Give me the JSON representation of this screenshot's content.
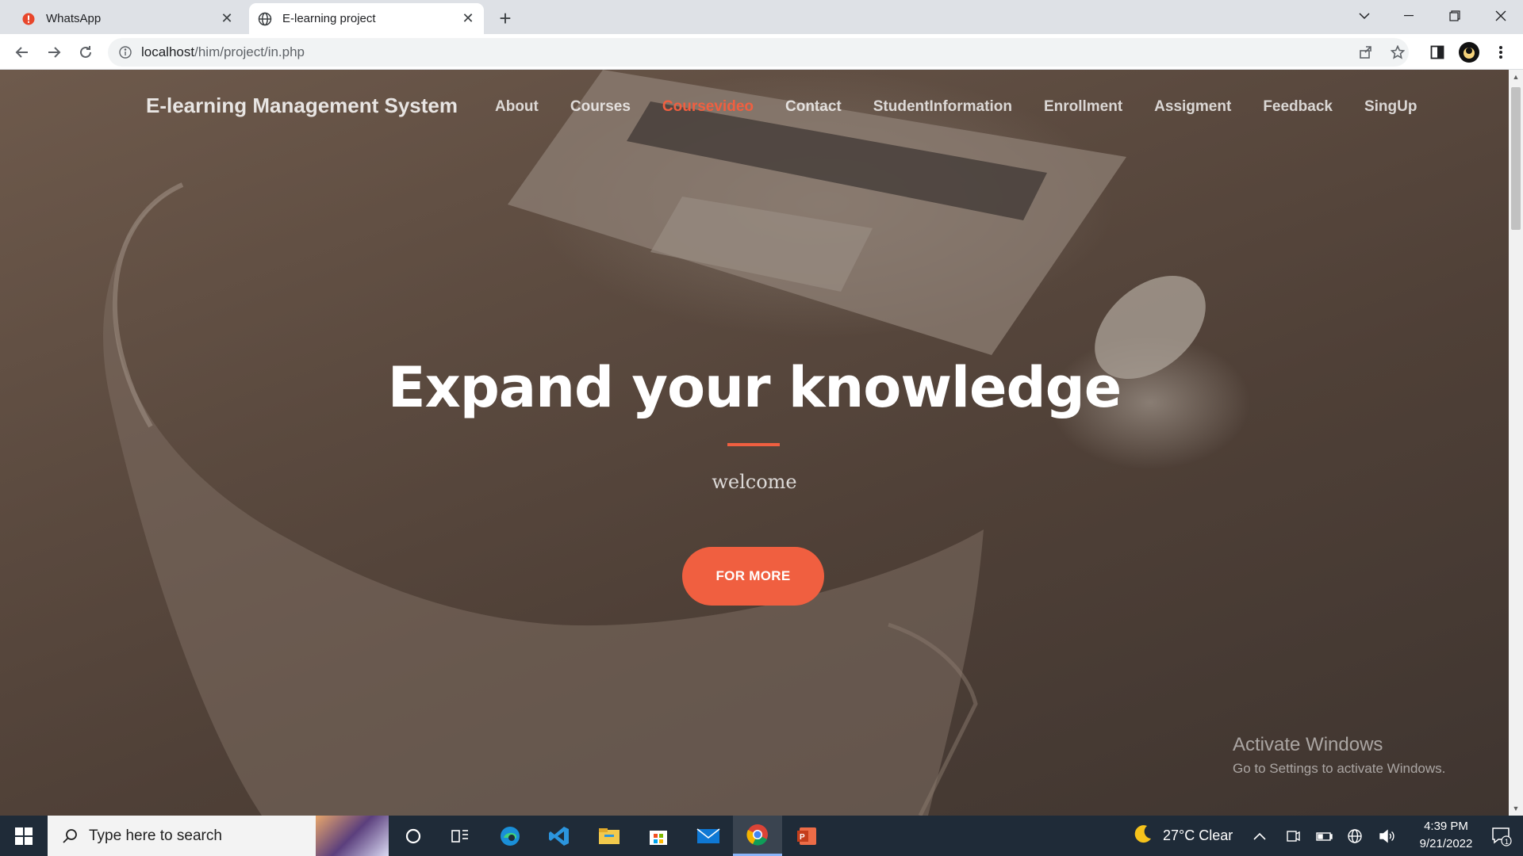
{
  "browser": {
    "tabs": [
      {
        "title": "WhatsApp",
        "favicon": "alert-icon",
        "active": false
      },
      {
        "title": "E-learning project",
        "favicon": "globe-icon",
        "active": true
      }
    ],
    "new_tab_label": "+",
    "url_host": "localhost",
    "url_path": "/him/project/in.php"
  },
  "site": {
    "brand": "E-learning Management System",
    "nav": [
      {
        "label": "About",
        "active": false
      },
      {
        "label": "Courses",
        "active": false
      },
      {
        "label": "Coursevideo",
        "active": true
      },
      {
        "label": "Contact",
        "active": false
      },
      {
        "label": "StudentInformation",
        "active": false
      },
      {
        "label": "Enrollment",
        "active": false
      },
      {
        "label": "Assigment",
        "active": false
      },
      {
        "label": "Feedback",
        "active": false
      },
      {
        "label": "SingUp",
        "active": false
      }
    ],
    "hero_title": "Expand your knowledge",
    "hero_subtitle": "welcome",
    "cta_label": "FOR MORE",
    "accent_color": "#f05f40"
  },
  "watermark": {
    "title": "Activate Windows",
    "subtitle": "Go to Settings to activate Windows."
  },
  "taskbar": {
    "search_placeholder": "Type here to search",
    "apps": [
      "cortana-icon",
      "task-view-icon",
      "edge-icon",
      "vscode-icon",
      "file-explorer-icon",
      "store-icon",
      "mail-icon",
      "chrome-icon",
      "powerpoint-icon"
    ],
    "weather": "27°C  Clear",
    "time": "4:39 PM",
    "date": "9/21/2022",
    "notification_count": "1"
  }
}
